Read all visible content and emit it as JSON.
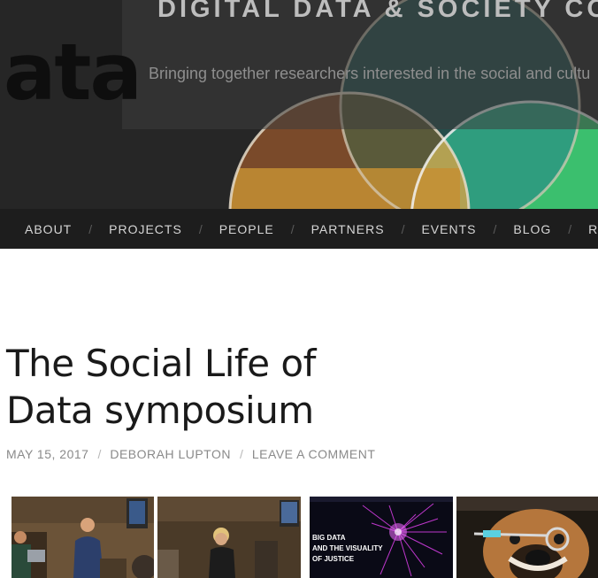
{
  "header": {
    "logo_text": "ata",
    "site_title": "DIGITAL DATA & SOCIETY CO",
    "tagline": "Bringing together researchers interested in the social and cultu"
  },
  "nav": {
    "items": [
      {
        "label": "ABOUT"
      },
      {
        "label": "PROJECTS"
      },
      {
        "label": "PEOPLE"
      },
      {
        "label": "PARTNERS"
      },
      {
        "label": "EVENTS"
      },
      {
        "label": "BLOG"
      },
      {
        "label": "RESOU"
      }
    ],
    "separator": "/"
  },
  "post": {
    "title": "The Social Life of Data symposium",
    "date": "MAY 15, 2017",
    "author": "DEBORAH LUPTON",
    "comments": "LEAVE A COMMENT"
  },
  "gallery": {
    "slide_lines": [
      "BIG DATA",
      "AND THE VISUALITY",
      "OF JUSTICE"
    ]
  },
  "colors": {
    "banner_bg": "#262626",
    "nav_bg": "#1d1d1d",
    "circle_brown": "#7a4a2a",
    "circle_teal": "#2a8a7a",
    "circle_green": "#3bbf6e",
    "circle_gold": "#c89a3a"
  }
}
